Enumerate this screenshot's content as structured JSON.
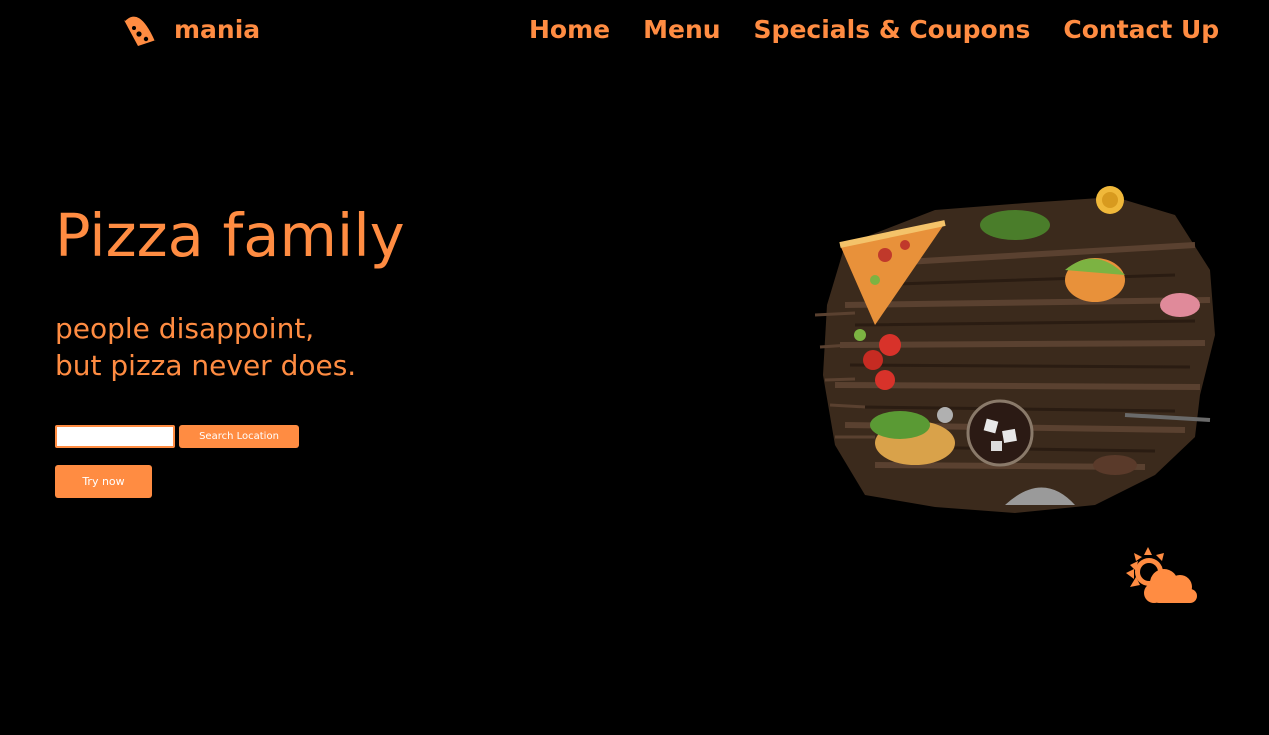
{
  "brand": {
    "name": "mania",
    "icon": "pizza-slice-icon",
    "color": "#ff8c42"
  },
  "nav": {
    "items": [
      "Home",
      "Menu",
      "Specials & Coupons",
      "Contact Up"
    ]
  },
  "hero": {
    "title": "Pizza family",
    "tagline_line1": "people disappoint,",
    "tagline_line2": "but pizza never does.",
    "search_value": "",
    "search_button": "Search Location",
    "try_button": "Try now",
    "image": "pizza-table-illustration",
    "weather_icon": "sun-cloud-icon"
  },
  "theme": {
    "background": "#000000",
    "accent": "#ff8c42",
    "button_text": "#ffffff"
  }
}
